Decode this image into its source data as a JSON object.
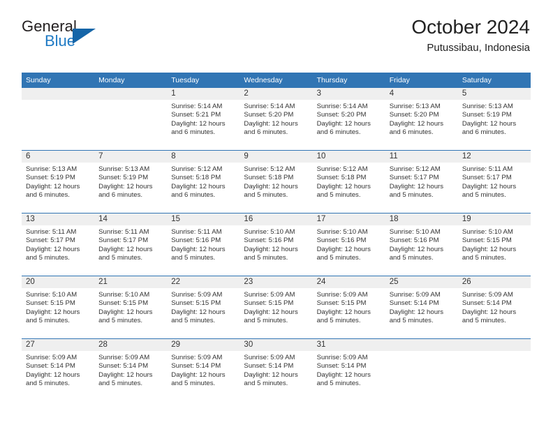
{
  "logo": {
    "line1": "General",
    "line2": "Blue",
    "triangle_color": "#1565a8",
    "blue_text_color": "#1f7ac4"
  },
  "header": {
    "title": "October 2024",
    "subtitle": "Putussibau, Indonesia"
  },
  "theme": {
    "header_blue": "#3175b4",
    "daynum_band": "#efefef",
    "text": "#333333"
  },
  "weekday_headers": [
    "Sunday",
    "Monday",
    "Tuesday",
    "Wednesday",
    "Thursday",
    "Friday",
    "Saturday"
  ],
  "labels": {
    "sunrise_prefix": "Sunrise:",
    "sunset_prefix": "Sunset:",
    "daylight_prefix": "Daylight:"
  },
  "weeks": [
    [
      {
        "day": ""
      },
      {
        "day": ""
      },
      {
        "day": "1",
        "sunrise": "Sunrise: 5:14 AM",
        "sunset": "Sunset: 5:21 PM",
        "daylight_l1": "Daylight: 12 hours",
        "daylight_l2": "and 6 minutes."
      },
      {
        "day": "2",
        "sunrise": "Sunrise: 5:14 AM",
        "sunset": "Sunset: 5:20 PM",
        "daylight_l1": "Daylight: 12 hours",
        "daylight_l2": "and 6 minutes."
      },
      {
        "day": "3",
        "sunrise": "Sunrise: 5:14 AM",
        "sunset": "Sunset: 5:20 PM",
        "daylight_l1": "Daylight: 12 hours",
        "daylight_l2": "and 6 minutes."
      },
      {
        "day": "4",
        "sunrise": "Sunrise: 5:13 AM",
        "sunset": "Sunset: 5:20 PM",
        "daylight_l1": "Daylight: 12 hours",
        "daylight_l2": "and 6 minutes."
      },
      {
        "day": "5",
        "sunrise": "Sunrise: 5:13 AM",
        "sunset": "Sunset: 5:19 PM",
        "daylight_l1": "Daylight: 12 hours",
        "daylight_l2": "and 6 minutes."
      }
    ],
    [
      {
        "day": "6",
        "sunrise": "Sunrise: 5:13 AM",
        "sunset": "Sunset: 5:19 PM",
        "daylight_l1": "Daylight: 12 hours",
        "daylight_l2": "and 6 minutes."
      },
      {
        "day": "7",
        "sunrise": "Sunrise: 5:13 AM",
        "sunset": "Sunset: 5:19 PM",
        "daylight_l1": "Daylight: 12 hours",
        "daylight_l2": "and 6 minutes."
      },
      {
        "day": "8",
        "sunrise": "Sunrise: 5:12 AM",
        "sunset": "Sunset: 5:18 PM",
        "daylight_l1": "Daylight: 12 hours",
        "daylight_l2": "and 6 minutes."
      },
      {
        "day": "9",
        "sunrise": "Sunrise: 5:12 AM",
        "sunset": "Sunset: 5:18 PM",
        "daylight_l1": "Daylight: 12 hours",
        "daylight_l2": "and 5 minutes."
      },
      {
        "day": "10",
        "sunrise": "Sunrise: 5:12 AM",
        "sunset": "Sunset: 5:18 PM",
        "daylight_l1": "Daylight: 12 hours",
        "daylight_l2": "and 5 minutes."
      },
      {
        "day": "11",
        "sunrise": "Sunrise: 5:12 AM",
        "sunset": "Sunset: 5:17 PM",
        "daylight_l1": "Daylight: 12 hours",
        "daylight_l2": "and 5 minutes."
      },
      {
        "day": "12",
        "sunrise": "Sunrise: 5:11 AM",
        "sunset": "Sunset: 5:17 PM",
        "daylight_l1": "Daylight: 12 hours",
        "daylight_l2": "and 5 minutes."
      }
    ],
    [
      {
        "day": "13",
        "sunrise": "Sunrise: 5:11 AM",
        "sunset": "Sunset: 5:17 PM",
        "daylight_l1": "Daylight: 12 hours",
        "daylight_l2": "and 5 minutes."
      },
      {
        "day": "14",
        "sunrise": "Sunrise: 5:11 AM",
        "sunset": "Sunset: 5:17 PM",
        "daylight_l1": "Daylight: 12 hours",
        "daylight_l2": "and 5 minutes."
      },
      {
        "day": "15",
        "sunrise": "Sunrise: 5:11 AM",
        "sunset": "Sunset: 5:16 PM",
        "daylight_l1": "Daylight: 12 hours",
        "daylight_l2": "and 5 minutes."
      },
      {
        "day": "16",
        "sunrise": "Sunrise: 5:10 AM",
        "sunset": "Sunset: 5:16 PM",
        "daylight_l1": "Daylight: 12 hours",
        "daylight_l2": "and 5 minutes."
      },
      {
        "day": "17",
        "sunrise": "Sunrise: 5:10 AM",
        "sunset": "Sunset: 5:16 PM",
        "daylight_l1": "Daylight: 12 hours",
        "daylight_l2": "and 5 minutes."
      },
      {
        "day": "18",
        "sunrise": "Sunrise: 5:10 AM",
        "sunset": "Sunset: 5:16 PM",
        "daylight_l1": "Daylight: 12 hours",
        "daylight_l2": "and 5 minutes."
      },
      {
        "day": "19",
        "sunrise": "Sunrise: 5:10 AM",
        "sunset": "Sunset: 5:15 PM",
        "daylight_l1": "Daylight: 12 hours",
        "daylight_l2": "and 5 minutes."
      }
    ],
    [
      {
        "day": "20",
        "sunrise": "Sunrise: 5:10 AM",
        "sunset": "Sunset: 5:15 PM",
        "daylight_l1": "Daylight: 12 hours",
        "daylight_l2": "and 5 minutes."
      },
      {
        "day": "21",
        "sunrise": "Sunrise: 5:10 AM",
        "sunset": "Sunset: 5:15 PM",
        "daylight_l1": "Daylight: 12 hours",
        "daylight_l2": "and 5 minutes."
      },
      {
        "day": "22",
        "sunrise": "Sunrise: 5:09 AM",
        "sunset": "Sunset: 5:15 PM",
        "daylight_l1": "Daylight: 12 hours",
        "daylight_l2": "and 5 minutes."
      },
      {
        "day": "23",
        "sunrise": "Sunrise: 5:09 AM",
        "sunset": "Sunset: 5:15 PM",
        "daylight_l1": "Daylight: 12 hours",
        "daylight_l2": "and 5 minutes."
      },
      {
        "day": "24",
        "sunrise": "Sunrise: 5:09 AM",
        "sunset": "Sunset: 5:15 PM",
        "daylight_l1": "Daylight: 12 hours",
        "daylight_l2": "and 5 minutes."
      },
      {
        "day": "25",
        "sunrise": "Sunrise: 5:09 AM",
        "sunset": "Sunset: 5:14 PM",
        "daylight_l1": "Daylight: 12 hours",
        "daylight_l2": "and 5 minutes."
      },
      {
        "day": "26",
        "sunrise": "Sunrise: 5:09 AM",
        "sunset": "Sunset: 5:14 PM",
        "daylight_l1": "Daylight: 12 hours",
        "daylight_l2": "and 5 minutes."
      }
    ],
    [
      {
        "day": "27",
        "sunrise": "Sunrise: 5:09 AM",
        "sunset": "Sunset: 5:14 PM",
        "daylight_l1": "Daylight: 12 hours",
        "daylight_l2": "and 5 minutes."
      },
      {
        "day": "28",
        "sunrise": "Sunrise: 5:09 AM",
        "sunset": "Sunset: 5:14 PM",
        "daylight_l1": "Daylight: 12 hours",
        "daylight_l2": "and 5 minutes."
      },
      {
        "day": "29",
        "sunrise": "Sunrise: 5:09 AM",
        "sunset": "Sunset: 5:14 PM",
        "daylight_l1": "Daylight: 12 hours",
        "daylight_l2": "and 5 minutes."
      },
      {
        "day": "30",
        "sunrise": "Sunrise: 5:09 AM",
        "sunset": "Sunset: 5:14 PM",
        "daylight_l1": "Daylight: 12 hours",
        "daylight_l2": "and 5 minutes."
      },
      {
        "day": "31",
        "sunrise": "Sunrise: 5:09 AM",
        "sunset": "Sunset: 5:14 PM",
        "daylight_l1": "Daylight: 12 hours",
        "daylight_l2": "and 5 minutes."
      },
      {
        "day": ""
      },
      {
        "day": ""
      }
    ]
  ]
}
